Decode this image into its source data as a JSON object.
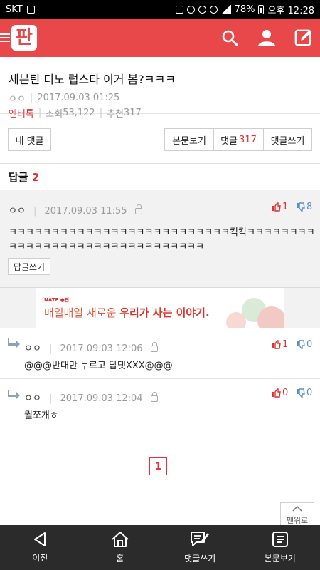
{
  "status_bar": {
    "carrier": "SKT",
    "battery": "78%",
    "time": "오후 12:28"
  },
  "app": {
    "logo_text": "판",
    "accent_color": "#e8484a"
  },
  "post": {
    "title": "세븐틴 디노 럽스타 이거 봄?ㅋㅋㅋ",
    "author": "ㅇㅇ",
    "datetime": "2017.09.03 01:25",
    "category": "엔터톡",
    "views_label": "조회",
    "views": "53,122",
    "likes_label": "추천",
    "likes": "317"
  },
  "buttons": {
    "my_comments": "내 댓글",
    "view_post": "본문보기",
    "comments_label": "댓글",
    "comments_count": "317",
    "write_comment": "댓글쓰기"
  },
  "reply_section": {
    "label": "답글",
    "count": "2"
  },
  "main_comment": {
    "author": "ㅇㅇ",
    "datetime": "2017.09.03 11:55",
    "up": "1",
    "down": "8",
    "body_line1": "ㅋㅋㅋㅋㅋㅋㅋㅋㅋㅋㅋㅋㅋㅋㅋㅋㅋㅋㅋㅋㅋㅋㅋㅋㅋㅋ킥킥ㅋㅋㅋㅋㅋㅋㅋㅋ",
    "body_line2": "ㅋㅋㅋㅋㅋㅋㅋㅋㅋㅋㅋㅋㅋㅋㅋㅋㅋㅋㅋㅋㅋㅋㅋ",
    "reply_button": "답글쓰기"
  },
  "ad": {
    "brand": "NATE ●판",
    "text_prefix": "매일매일 새로운 ",
    "text_highlight": "우리가 사는 이야기."
  },
  "replies": [
    {
      "author": "ㅇㅇ",
      "datetime": "2017.09.03 12:06",
      "up": "1",
      "down": "0",
      "body": "@@@반대만 누르고 답댓XXX@@@"
    },
    {
      "author": "ㅇㅇ",
      "datetime": "2017.09.03 12:04",
      "up": "0",
      "down": "0",
      "body": "뭘쪼개ㅎ"
    }
  ],
  "pagination": {
    "current": "1"
  },
  "to_top": {
    "label": "맨위로"
  },
  "bottom_nav": {
    "back": "이전",
    "home": "홈",
    "write_comment": "댓글쓰기",
    "view_post": "본문보기"
  }
}
